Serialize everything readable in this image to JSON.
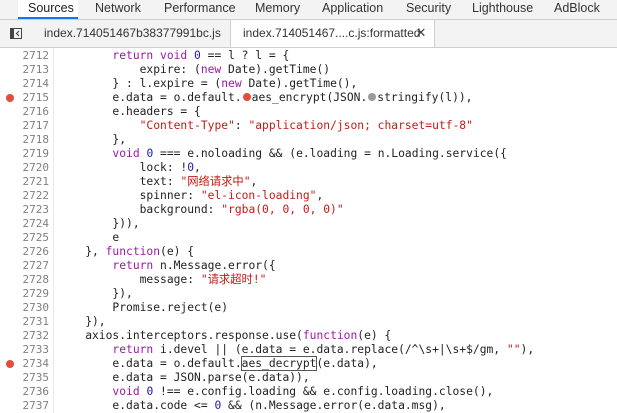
{
  "tabs": [
    {
      "label": "Sources",
      "active": true
    },
    {
      "label": "Network",
      "active": false
    },
    {
      "label": "Performance",
      "active": false
    },
    {
      "label": "Memory",
      "active": false
    },
    {
      "label": "Application",
      "active": false
    },
    {
      "label": "Security",
      "active": false
    },
    {
      "label": "Lighthouse",
      "active": false
    },
    {
      "label": "AdBlock",
      "active": false
    }
  ],
  "file_tabs": [
    {
      "label": "index.714051467b38377991bc.js",
      "active": false
    },
    {
      "label": "index.714051467....c.js:formatted",
      "active": true
    }
  ],
  "file_tab_close": "✕",
  "colors": {
    "accent": "#1a73e8",
    "breakpoint": "#e54c3c",
    "keyword": "#9b1aa3",
    "string": "#c41a16",
    "number": "#1a1aa6"
  },
  "code_lines": [
    {
      "num": "2712",
      "bp": false,
      "segs": [
        [
          "p",
          "        "
        ],
        [
          "k",
          "return "
        ],
        [
          "k",
          "void "
        ],
        [
          "n",
          "0"
        ],
        [
          "p",
          " == l ? l = {"
        ]
      ]
    },
    {
      "num": "2713",
      "bp": false,
      "segs": [
        [
          "p",
          "            expire: ("
        ],
        [
          "k",
          "new "
        ],
        [
          "p",
          "Date).getTime()"
        ]
      ]
    },
    {
      "num": "2714",
      "bp": false,
      "segs": [
        [
          "p",
          "        } : l.expire = ("
        ],
        [
          "k",
          "new "
        ],
        [
          "p",
          "Date).getTime(),"
        ]
      ]
    },
    {
      "num": "2715",
      "bp": true,
      "segs": [
        [
          "p",
          "        e.data = o.default."
        ],
        [
          "bp",
          ""
        ],
        [
          "p",
          "aes_encrypt(JSON."
        ],
        [
          "bpg",
          ""
        ],
        [
          "p",
          "stringify(l)),"
        ]
      ]
    },
    {
      "num": "2716",
      "bp": false,
      "segs": [
        [
          "p",
          "        e.headers = {"
        ]
      ]
    },
    {
      "num": "2717",
      "bp": false,
      "segs": [
        [
          "p",
          "            "
        ],
        [
          "s",
          "\"Content-Type\""
        ],
        [
          "p",
          ": "
        ],
        [
          "s",
          "\"application/json; charset=utf-8\""
        ]
      ]
    },
    {
      "num": "2718",
      "bp": false,
      "segs": [
        [
          "p",
          "        },"
        ]
      ]
    },
    {
      "num": "2719",
      "bp": false,
      "segs": [
        [
          "p",
          "        "
        ],
        [
          "k",
          "void "
        ],
        [
          "n",
          "0"
        ],
        [
          "p",
          " === e.noloading && (e.loading = n.Loading.service({"
        ]
      ]
    },
    {
      "num": "2720",
      "bp": false,
      "segs": [
        [
          "p",
          "            lock: !"
        ],
        [
          "n",
          "0"
        ],
        [
          "p",
          ","
        ]
      ]
    },
    {
      "num": "2721",
      "bp": false,
      "segs": [
        [
          "p",
          "            text: "
        ],
        [
          "s",
          "\"网络请求中\""
        ],
        [
          "p",
          ","
        ]
      ]
    },
    {
      "num": "2722",
      "bp": false,
      "segs": [
        [
          "p",
          "            spinner: "
        ],
        [
          "s",
          "\"el-icon-loading\""
        ],
        [
          "p",
          ","
        ]
      ]
    },
    {
      "num": "2723",
      "bp": false,
      "segs": [
        [
          "p",
          "            background: "
        ],
        [
          "s",
          "\"rgba(0, 0, 0, 0)\""
        ]
      ]
    },
    {
      "num": "2724",
      "bp": false,
      "segs": [
        [
          "p",
          "        })),"
        ]
      ]
    },
    {
      "num": "2725",
      "bp": false,
      "segs": [
        [
          "p",
          "        e"
        ]
      ]
    },
    {
      "num": "2726",
      "bp": false,
      "segs": [
        [
          "p",
          "    }, "
        ],
        [
          "k",
          "function"
        ],
        [
          "p",
          "(e) {"
        ]
      ]
    },
    {
      "num": "2727",
      "bp": false,
      "segs": [
        [
          "p",
          "        "
        ],
        [
          "k",
          "return "
        ],
        [
          "p",
          "n.Message.error({"
        ]
      ]
    },
    {
      "num": "2728",
      "bp": false,
      "segs": [
        [
          "p",
          "            message: "
        ],
        [
          "s",
          "\"请求超时!\""
        ]
      ]
    },
    {
      "num": "2729",
      "bp": false,
      "segs": [
        [
          "p",
          "        }),"
        ]
      ]
    },
    {
      "num": "2730",
      "bp": false,
      "segs": [
        [
          "p",
          "        Promise.reject(e)"
        ]
      ]
    },
    {
      "num": "2731",
      "bp": false,
      "segs": [
        [
          "p",
          "    }),"
        ]
      ]
    },
    {
      "num": "2732",
      "bp": false,
      "segs": [
        [
          "p",
          "    axios.interceptors.response.use("
        ],
        [
          "k",
          "function"
        ],
        [
          "p",
          "(e) {"
        ]
      ]
    },
    {
      "num": "2733",
      "bp": false,
      "segs": [
        [
          "p",
          "        "
        ],
        [
          "k",
          "return "
        ],
        [
          "p",
          "i.devel || (e.data = e.data.replace(/^\\s+|\\s+$/gm, "
        ],
        [
          "s",
          "\"\""
        ],
        [
          "p",
          "),"
        ]
      ]
    },
    {
      "num": "2734",
      "bp": true,
      "segs": [
        [
          "p",
          "        e.data = o.default."
        ],
        [
          "hl",
          "aes_decrypt"
        ],
        [
          "p",
          "(e.data),"
        ]
      ]
    },
    {
      "num": "2735",
      "bp": false,
      "segs": [
        [
          "p",
          "        e.data = JSON.parse(e.data)),"
        ]
      ]
    },
    {
      "num": "2736",
      "bp": false,
      "segs": [
        [
          "p",
          "        "
        ],
        [
          "k",
          "void "
        ],
        [
          "n",
          "0"
        ],
        [
          "p",
          " !== e.config.loading && e.config.loading.close(),"
        ]
      ]
    },
    {
      "num": "2737",
      "bp": false,
      "segs": [
        [
          "p",
          "        e.data.code <= "
        ],
        [
          "n",
          "0"
        ],
        [
          "p",
          " && (n.Message.error(e.data.msg),"
        ]
      ]
    }
  ]
}
